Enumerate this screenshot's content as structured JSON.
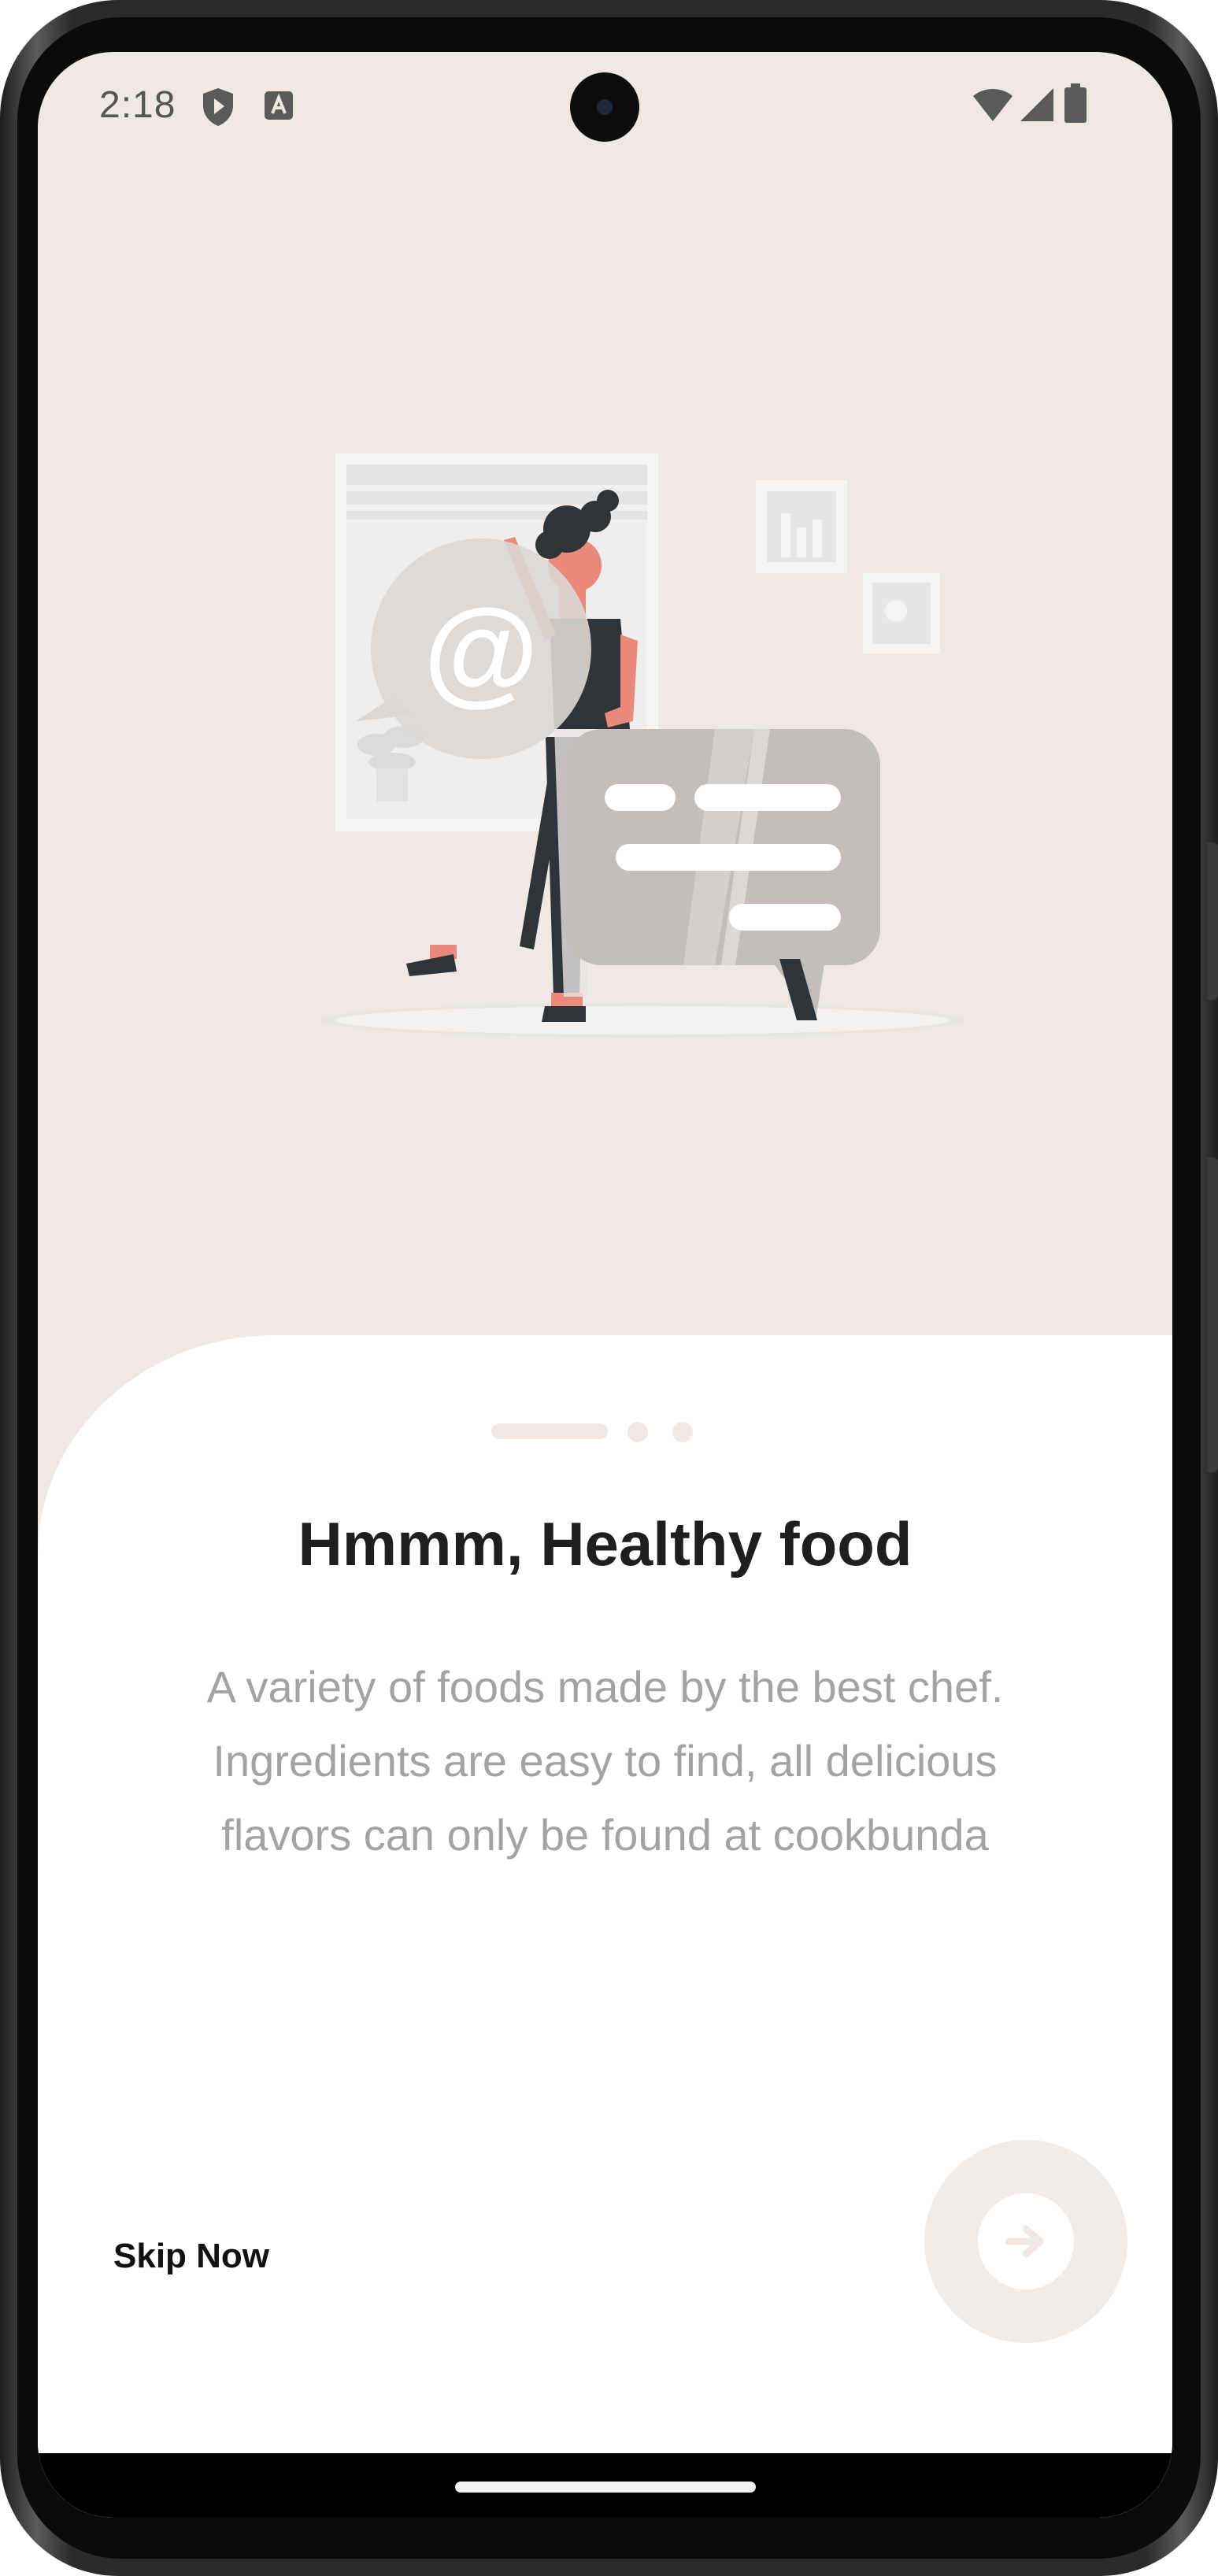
{
  "status_bar": {
    "time": "2:18",
    "icons": [
      "shield-icon",
      "translate-icon",
      "wifi-icon",
      "signal-icon",
      "battery-icon"
    ]
  },
  "onboarding": {
    "illustration": "woman-with-chat-bubble-illustration",
    "pager": {
      "total": 3,
      "active": 1
    },
    "title": "Hmmm, Healthy food",
    "description": "A variety of foods made by the best chef. Ingredients are easy to find, all delicious flavors can only be found at cookbunda",
    "skip_label": "Skip Now",
    "next_icon": "arrow-right-icon"
  },
  "colors": {
    "background": "#efe8e4",
    "card": "#ffffff",
    "title": "#1f1f1f",
    "description": "#a3a3a3",
    "accent": "#efe8e4"
  }
}
